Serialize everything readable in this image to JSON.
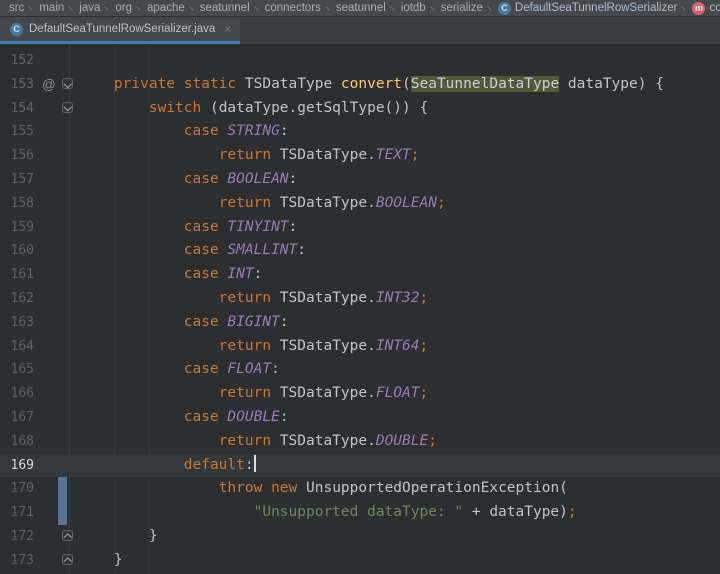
{
  "colors": {
    "editor_bg": "#2C2E30",
    "nav_bg": "#46494B",
    "tabbar_bg": "#3B3E40",
    "tab_bg": "#45484B",
    "tab_accent": "#3C7EBE",
    "keyword": "#CC7832",
    "method": "#FFC66D",
    "enum_constant": "#9A7BB5",
    "string": "#6A8759",
    "default_text": "#BEC4CA",
    "line_number": "#5E6366",
    "identifier_highlight_bg": "#50583A",
    "vcs_change_marker": "#537699"
  },
  "nav": {
    "items": [
      {
        "label": "src"
      },
      {
        "label": "main"
      },
      {
        "label": "java"
      },
      {
        "label": "org"
      },
      {
        "label": "apache"
      },
      {
        "label": "seatunnel"
      },
      {
        "label": "connectors"
      },
      {
        "label": "seatunnel"
      },
      {
        "label": "iotdb"
      },
      {
        "label": "serialize"
      },
      {
        "label": "DefaultSeaTunnelRowSerializer",
        "icon": "class",
        "letter": "C"
      },
      {
        "label": "convert",
        "icon": "method",
        "letter": "m"
      }
    ]
  },
  "tab": {
    "title": "DefaultSeaTunnelRowSerializer.java",
    "icon_letter": "C",
    "close_glyph": "×"
  },
  "editor": {
    "annotation_glyph": "@",
    "lines": [
      {
        "n": "152",
        "t": []
      },
      {
        "n": "153",
        "at": true,
        "fold": "down",
        "t": [
          [
            "w",
            "    "
          ],
          [
            "k",
            "private"
          ],
          [
            "w",
            " "
          ],
          [
            "k",
            "static"
          ],
          [
            "w",
            " TSDataType "
          ],
          [
            "m",
            "convert"
          ],
          [
            "w",
            "("
          ],
          [
            "hl",
            "SeaTunnelDataType"
          ],
          [
            "w",
            " dataType"
          ],
          [
            "w",
            ") {"
          ]
        ]
      },
      {
        "n": "154",
        "fold": "down",
        "t": [
          [
            "w",
            "        "
          ],
          [
            "k",
            "switch"
          ],
          [
            "w",
            " (dataType.getSqlType()) {"
          ]
        ]
      },
      {
        "n": "155",
        "t": [
          [
            "w",
            "            "
          ],
          [
            "k",
            "case"
          ],
          [
            "w",
            " "
          ],
          [
            "e",
            "STRING"
          ],
          [
            "w",
            ":"
          ]
        ]
      },
      {
        "n": "156",
        "t": [
          [
            "w",
            "                "
          ],
          [
            "k",
            "return"
          ],
          [
            "w",
            " TSDataType."
          ],
          [
            "e",
            "TEXT"
          ],
          [
            "k",
            ";"
          ]
        ]
      },
      {
        "n": "157",
        "t": [
          [
            "w",
            "            "
          ],
          [
            "k",
            "case"
          ],
          [
            "w",
            " "
          ],
          [
            "e",
            "BOOLEAN"
          ],
          [
            "w",
            ":"
          ]
        ]
      },
      {
        "n": "158",
        "t": [
          [
            "w",
            "                "
          ],
          [
            "k",
            "return"
          ],
          [
            "w",
            " TSDataType."
          ],
          [
            "e",
            "BOOLEAN"
          ],
          [
            "k",
            ";"
          ]
        ]
      },
      {
        "n": "159",
        "t": [
          [
            "w",
            "            "
          ],
          [
            "k",
            "case"
          ],
          [
            "w",
            " "
          ],
          [
            "e",
            "TINYINT"
          ],
          [
            "w",
            ":"
          ]
        ]
      },
      {
        "n": "160",
        "t": [
          [
            "w",
            "            "
          ],
          [
            "k",
            "case"
          ],
          [
            "w",
            " "
          ],
          [
            "e",
            "SMALLINT"
          ],
          [
            "w",
            ":"
          ]
        ]
      },
      {
        "n": "161",
        "t": [
          [
            "w",
            "            "
          ],
          [
            "k",
            "case"
          ],
          [
            "w",
            " "
          ],
          [
            "e",
            "INT"
          ],
          [
            "w",
            ":"
          ]
        ]
      },
      {
        "n": "162",
        "t": [
          [
            "w",
            "                "
          ],
          [
            "k",
            "return"
          ],
          [
            "w",
            " TSDataType."
          ],
          [
            "e",
            "INT32"
          ],
          [
            "k",
            ";"
          ]
        ]
      },
      {
        "n": "163",
        "t": [
          [
            "w",
            "            "
          ],
          [
            "k",
            "case"
          ],
          [
            "w",
            " "
          ],
          [
            "e",
            "BIGINT"
          ],
          [
            "w",
            ":"
          ]
        ]
      },
      {
        "n": "164",
        "t": [
          [
            "w",
            "                "
          ],
          [
            "k",
            "return"
          ],
          [
            "w",
            " TSDataType."
          ],
          [
            "e",
            "INT64"
          ],
          [
            "k",
            ";"
          ]
        ]
      },
      {
        "n": "165",
        "t": [
          [
            "w",
            "            "
          ],
          [
            "k",
            "case"
          ],
          [
            "w",
            " "
          ],
          [
            "e",
            "FLOAT"
          ],
          [
            "w",
            ":"
          ]
        ]
      },
      {
        "n": "166",
        "t": [
          [
            "w",
            "                "
          ],
          [
            "k",
            "return"
          ],
          [
            "w",
            " TSDataType."
          ],
          [
            "e",
            "FLOAT"
          ],
          [
            "k",
            ";"
          ]
        ]
      },
      {
        "n": "167",
        "t": [
          [
            "w",
            "            "
          ],
          [
            "k",
            "case"
          ],
          [
            "w",
            " "
          ],
          [
            "e",
            "DOUBLE"
          ],
          [
            "w",
            ":"
          ]
        ]
      },
      {
        "n": "168",
        "t": [
          [
            "w",
            "                "
          ],
          [
            "k",
            "return"
          ],
          [
            "w",
            " TSDataType."
          ],
          [
            "e",
            "DOUBLE"
          ],
          [
            "k",
            ";"
          ]
        ]
      },
      {
        "n": "169",
        "active": true,
        "t": [
          [
            "w",
            "            "
          ],
          [
            "k",
            "default"
          ],
          [
            "w",
            ":"
          ],
          [
            "caret",
            ""
          ]
        ]
      },
      {
        "n": "170",
        "changed": true,
        "t": [
          [
            "w",
            "                "
          ],
          [
            "k",
            "throw"
          ],
          [
            "w",
            " "
          ],
          [
            "k",
            "new"
          ],
          [
            "w",
            " UnsupportedOperationException("
          ]
        ]
      },
      {
        "n": "171",
        "changed": true,
        "t": [
          [
            "w",
            "                    "
          ],
          [
            "s",
            "\"Unsupported dataType: \""
          ],
          [
            "w",
            " + dataType)"
          ],
          [
            "k",
            ";"
          ]
        ]
      },
      {
        "n": "172",
        "fold": "up",
        "t": [
          [
            "w",
            "        }"
          ]
        ]
      },
      {
        "n": "173",
        "fold": "up",
        "t": [
          [
            "w",
            "    }"
          ]
        ]
      }
    ]
  }
}
